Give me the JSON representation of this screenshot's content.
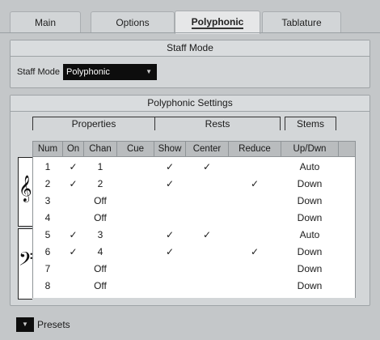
{
  "tabs": [
    {
      "label": "Main",
      "active": false
    },
    {
      "label": "Options",
      "active": false
    },
    {
      "label": "Polyphonic",
      "active": true
    },
    {
      "label": "Tablature",
      "active": false
    }
  ],
  "staff_mode": {
    "section_title": "Staff Mode",
    "label": "Staff Mode",
    "value": "Polyphonic"
  },
  "poly": {
    "section_title": "Polyphonic Settings",
    "groups": {
      "properties": "Properties",
      "rests": "Rests",
      "stems": "Stems"
    },
    "columns": [
      "Num",
      "On",
      "Chan",
      "Cue",
      "Show",
      "Center",
      "Reduce",
      "Up/Dwn"
    ],
    "rows": [
      [
        "1",
        "✓",
        "1",
        "",
        "✓",
        "✓",
        "",
        "Auto"
      ],
      [
        "2",
        "✓",
        "2",
        "",
        "✓",
        "",
        "✓",
        "Down"
      ],
      [
        "3",
        "",
        "Off",
        "",
        "",
        "",
        "",
        "Down"
      ],
      [
        "4",
        "",
        "Off",
        "",
        "",
        "",
        "",
        "Down"
      ],
      [
        "5",
        "✓",
        "3",
        "",
        "✓",
        "✓",
        "",
        "Auto"
      ],
      [
        "6",
        "✓",
        "4",
        "",
        "✓",
        "",
        "✓",
        "Down"
      ],
      [
        "7",
        "",
        "Off",
        "",
        "",
        "",
        "",
        "Down"
      ],
      [
        "8",
        "",
        "Off",
        "",
        "",
        "",
        "",
        "Down"
      ]
    ],
    "clefs": {
      "treble": "𝄞",
      "bass": "𝄢"
    }
  },
  "presets": {
    "label": "Presets",
    "button_icon": "dropdown-arrow-icon"
  },
  "colors": {
    "selected_bg": "#0d0d0d",
    "panel_bg": "#d3d6d8",
    "table_bg": "#ffffff"
  }
}
